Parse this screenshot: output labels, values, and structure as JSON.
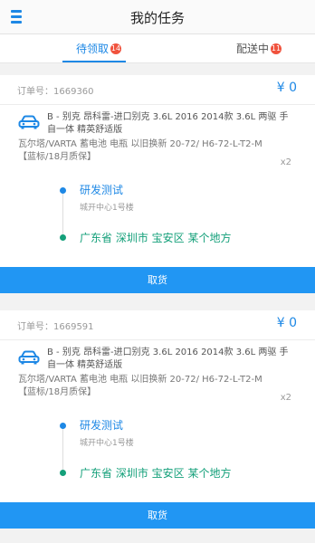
{
  "header": {
    "title": "我的任务"
  },
  "tabs": [
    {
      "label": "待领取",
      "badge": "14"
    },
    {
      "label": "配送中",
      "badge": "11"
    }
  ],
  "orders": [
    {
      "order_no": "订单号：1669360",
      "price": "¥ 0",
      "product_title": "B - 别克 昂科雷-进口别克 3.6L 2016 2014款 3.6L 两驱 手自一体 精英舒适版",
      "product_desc": "瓦尔塔/VARTA 蓄电池 电瓶 以旧换新 20-72/ H6-72-L-T2-M【蓝标/18月质保】",
      "quantity": "x2",
      "from_name": "研发测试",
      "from_address": "城开中心1号楼",
      "to_address": "广东省 深圳市 宝安区 某个地方",
      "action_label": "取货"
    },
    {
      "order_no": "订单号：1669591",
      "price": "¥ 0",
      "product_title": "B - 别克 昂科雷-进口别克 3.6L 2016 2014款 3.6L 两驱 手自一体 精英舒适版",
      "product_desc": "瓦尔塔/VARTA 蓄电池 电瓶 以旧换新 20-72/ H6-72-L-T2-M【蓝标/18月质保】",
      "quantity": "x2",
      "from_name": "研发测试",
      "from_address": "城开中心1号楼",
      "to_address": "广东省 深圳市 宝安区 某个地方",
      "action_label": "取货"
    }
  ],
  "colors": {
    "accent": "#1e88e5",
    "button": "#2196f3",
    "destination": "#14a07a",
    "badge": "#f0523d"
  },
  "icons": {
    "menu": "menu-icon",
    "product": "car-icon"
  }
}
